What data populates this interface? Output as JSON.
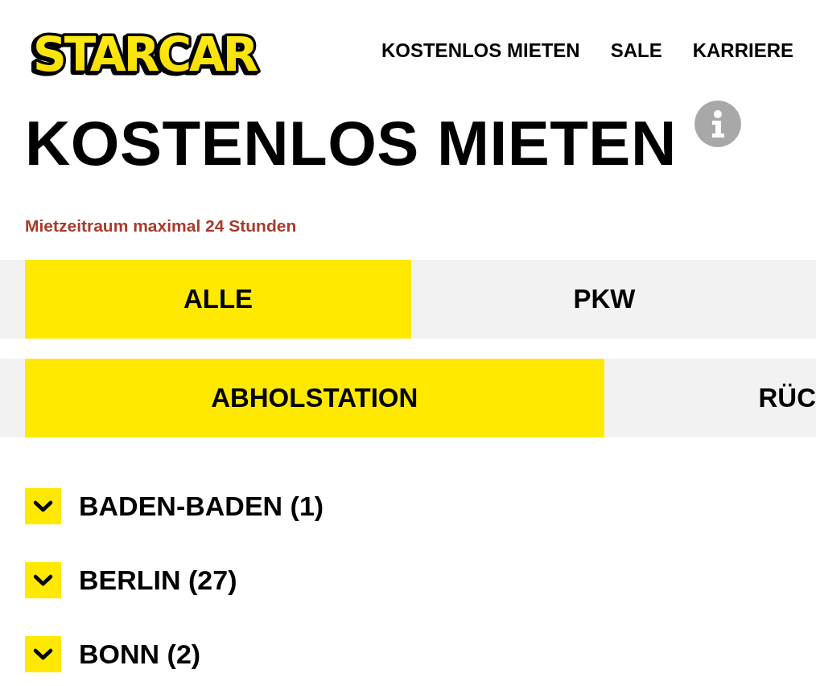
{
  "logo": "STARCAR",
  "nav": [
    "KOSTENLOS MIETEN",
    "SALE",
    "KARRIERE"
  ],
  "title": "KOSTENLOS MIETEN",
  "notice": "Mietzeitraum maximal 24 Stunden",
  "vehicle_tabs": [
    {
      "label": "ALLE",
      "selected": true
    },
    {
      "label": "PKW",
      "selected": false
    }
  ],
  "station_tabs": [
    {
      "label": "ABHOLSTATION",
      "selected": true
    },
    {
      "label": "RÜC",
      "selected": false
    }
  ],
  "cities": [
    {
      "label": "BADEN-BADEN (1)",
      "expanded": false
    },
    {
      "label": "BERLIN (27)",
      "expanded": false
    },
    {
      "label": "BONN (2)",
      "expanded": false
    }
  ]
}
